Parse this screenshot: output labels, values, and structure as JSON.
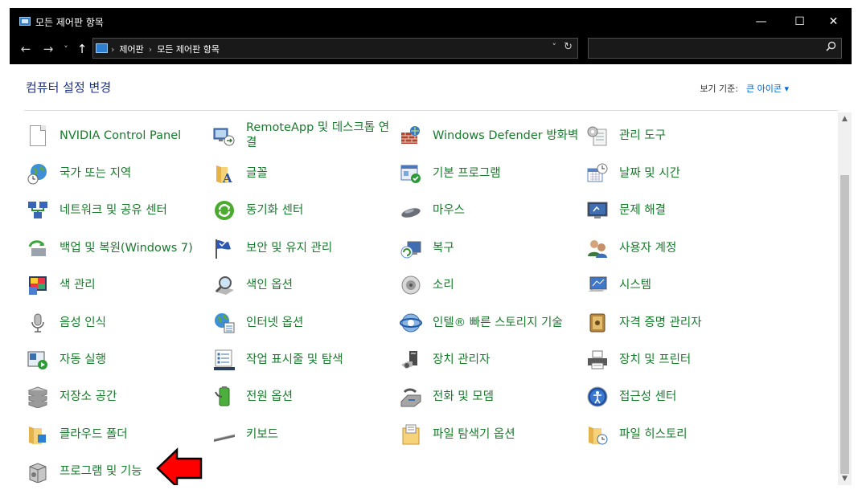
{
  "window": {
    "title": "모든 제어판 항목",
    "minimize": "—",
    "maximize": "☐",
    "close": "✕"
  },
  "nav": {
    "back": "←",
    "forward": "→",
    "recent": "˅",
    "up": "↑",
    "breadcrumbs": [
      "제어판",
      "모든 제어판 항목"
    ],
    "separator": "›",
    "dropdown": "˅",
    "refresh": "↻",
    "search_placeholder": ""
  },
  "header": {
    "title": "컴퓨터 설정 변경",
    "view_by_label": "보기 기준:",
    "view_by_value": "큰 아이콘 ▾"
  },
  "items": [
    {
      "label": "NVIDIA Control Panel",
      "icon": "blank-document-icon"
    },
    {
      "label": "RemoteApp 및 데스크톱 연결",
      "icon": "remoteapp-icon"
    },
    {
      "label": "Windows Defender 방화벽",
      "icon": "firewall-icon"
    },
    {
      "label": "관리 도구",
      "icon": "admin-tools-icon"
    },
    {
      "label": "국가 또는 지역",
      "icon": "globe-clock-icon"
    },
    {
      "label": "글꼴",
      "icon": "fonts-folder-icon"
    },
    {
      "label": "기본 프로그램",
      "icon": "default-programs-icon"
    },
    {
      "label": "날짜 및 시간",
      "icon": "calendar-clock-icon"
    },
    {
      "label": "네트워크 및 공유 센터",
      "icon": "network-icon"
    },
    {
      "label": "동기화 센터",
      "icon": "sync-icon"
    },
    {
      "label": "마우스",
      "icon": "mouse-icon"
    },
    {
      "label": "문제 해결",
      "icon": "troubleshoot-icon"
    },
    {
      "label": "백업 및 복원(Windows 7)",
      "icon": "backup-icon"
    },
    {
      "label": "보안 및 유지 관리",
      "icon": "flag-icon"
    },
    {
      "label": "복구",
      "icon": "recovery-icon"
    },
    {
      "label": "사용자 계정",
      "icon": "user-accounts-icon"
    },
    {
      "label": "색 관리",
      "icon": "color-management-icon"
    },
    {
      "label": "색인 옵션",
      "icon": "indexing-icon"
    },
    {
      "label": "소리",
      "icon": "speaker-icon"
    },
    {
      "label": "시스템",
      "icon": "system-icon"
    },
    {
      "label": "음성 인식",
      "icon": "microphone-icon"
    },
    {
      "label": "인터넷 옵션",
      "icon": "internet-options-icon"
    },
    {
      "label": "인텔® 빠른 스토리지 기술",
      "icon": "intel-storage-icon"
    },
    {
      "label": "자격 증명 관리자",
      "icon": "credential-vault-icon"
    },
    {
      "label": "자동 실행",
      "icon": "autoplay-icon"
    },
    {
      "label": "작업 표시줄 및 탐색",
      "icon": "taskbar-icon"
    },
    {
      "label": "장치 관리자",
      "icon": "device-manager-icon"
    },
    {
      "label": "장치 및 프린터",
      "icon": "printer-icon"
    },
    {
      "label": "저장소 공간",
      "icon": "storage-spaces-icon"
    },
    {
      "label": "전원 옵션",
      "icon": "power-options-icon"
    },
    {
      "label": "전화 및 모뎀",
      "icon": "phone-modem-icon"
    },
    {
      "label": "접근성 센터",
      "icon": "ease-of-access-icon"
    },
    {
      "label": "클라우드 폴더",
      "icon": "cloud-folder-icon"
    },
    {
      "label": "키보드",
      "icon": "keyboard-icon"
    },
    {
      "label": "파일 탐색기 옵션",
      "icon": "folder-options-icon"
    },
    {
      "label": "파일 히스토리",
      "icon": "file-history-icon"
    },
    {
      "label": "프로그램 및 기능",
      "icon": "programs-features-icon"
    }
  ],
  "colors": {
    "link_green": "#1a7a2e",
    "heading_blue": "#1e3287",
    "arrow_red": "#ff0000"
  }
}
